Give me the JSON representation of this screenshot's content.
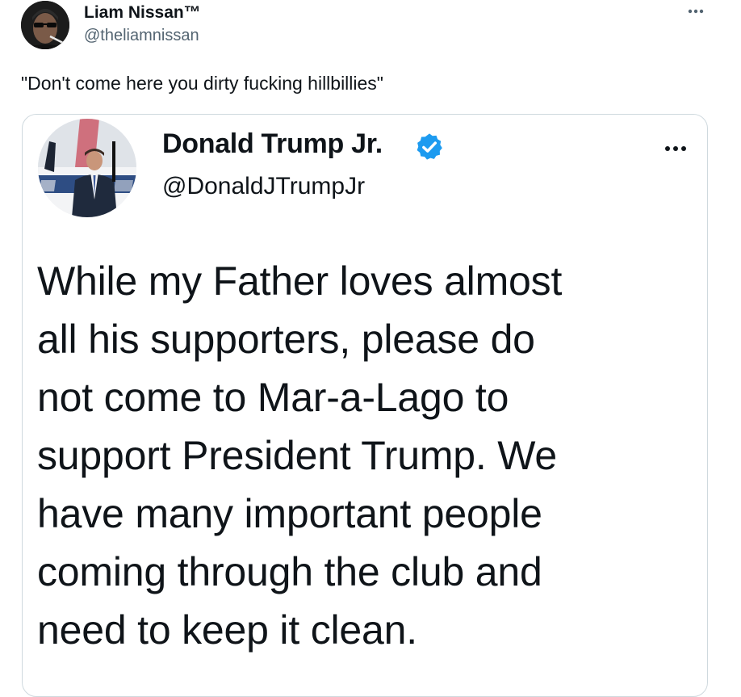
{
  "tweet": {
    "author_name": "Liam Nissan™",
    "author_handle": "@theliamnissan",
    "text": "\"Don't come here you dirty fucking hillbillies\"",
    "more_icon": "ellipsis-icon"
  },
  "quoted_tweet": {
    "author_name": "Donald Trump Jr.",
    "author_handle": "@DonaldJTrumpJr",
    "verified": true,
    "verified_icon": "verified-badge-icon",
    "more_icon": "ellipsis-icon",
    "lines": [
      "While my Father loves almost",
      "all his supporters, please do",
      "not come to Mar-a-Lago to",
      "support President Trump. We",
      "have many important people",
      "coming through the club and",
      "need to keep it clean."
    ]
  },
  "colors": {
    "text": "#0f1419",
    "secondary_text": "#536471",
    "border": "#cfd9de",
    "verified_blue": "#1d9bf0"
  }
}
